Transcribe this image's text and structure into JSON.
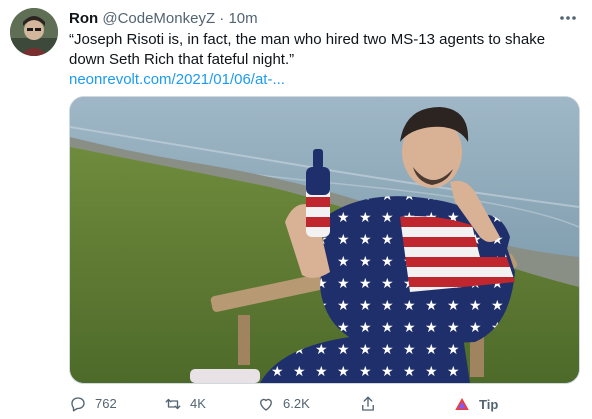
{
  "tweet": {
    "author_name": "Ron",
    "handle": "@CodeMonkeyZ",
    "separator": "·",
    "time": "10m",
    "text": "“Joseph Risoti is, in fact, the man who hired two MS-13 agents to shake down Seth Rich that fateful night.”",
    "link": "neonrevolt.com/2021/01/06/at-..."
  },
  "actions": {
    "replies": "762",
    "retweets": "4K",
    "likes": "6.2K",
    "tip_label": "Tip"
  },
  "colors": {
    "link": "#1d9bf0",
    "muted": "#536471",
    "text": "#0f1419"
  },
  "icons": [
    "more-icon",
    "reply-icon",
    "retweet-icon",
    "like-icon",
    "share-icon",
    "tip-icon"
  ]
}
